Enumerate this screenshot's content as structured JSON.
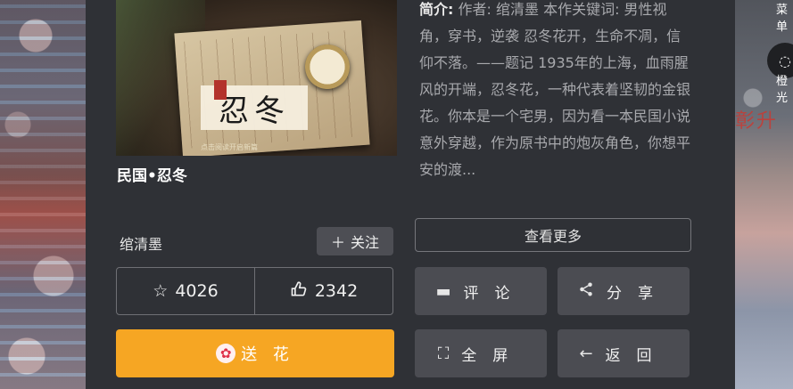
{
  "book": {
    "title": "民国•忍冬",
    "cover_title": "忍冬",
    "cover_tagline": "点击阅读开启新篇",
    "author": "绾清墨",
    "synopsis_label": "简介:",
    "synopsis": "作者: 绾清墨 本作关键词: 男性视角，穿书，逆袭 忍冬花开，生命不凋，信仰不落。——题记 1935年的上海，血雨腥风的开端，忍冬花，一种代表着坚韧的金银花。你本是一个宅男，因为看一本民国小说意外穿越，作为原书中的炮灰角色，你想平安的渡..."
  },
  "actions": {
    "follow_label": "关注",
    "more_label": "查看更多",
    "favorites": "4026",
    "likes": "2342",
    "flower_label": "送 花",
    "comment_label": "评论",
    "share_label": "分享",
    "fullscreen_label": "全屏",
    "back_label": "返回"
  },
  "side": {
    "menu_label": "菜单",
    "theme_label": "橙光",
    "poster_text": "彰升"
  },
  "colors": {
    "panel": "#2f3136",
    "accent": "#f6a623",
    "button": "#4b4c52"
  }
}
